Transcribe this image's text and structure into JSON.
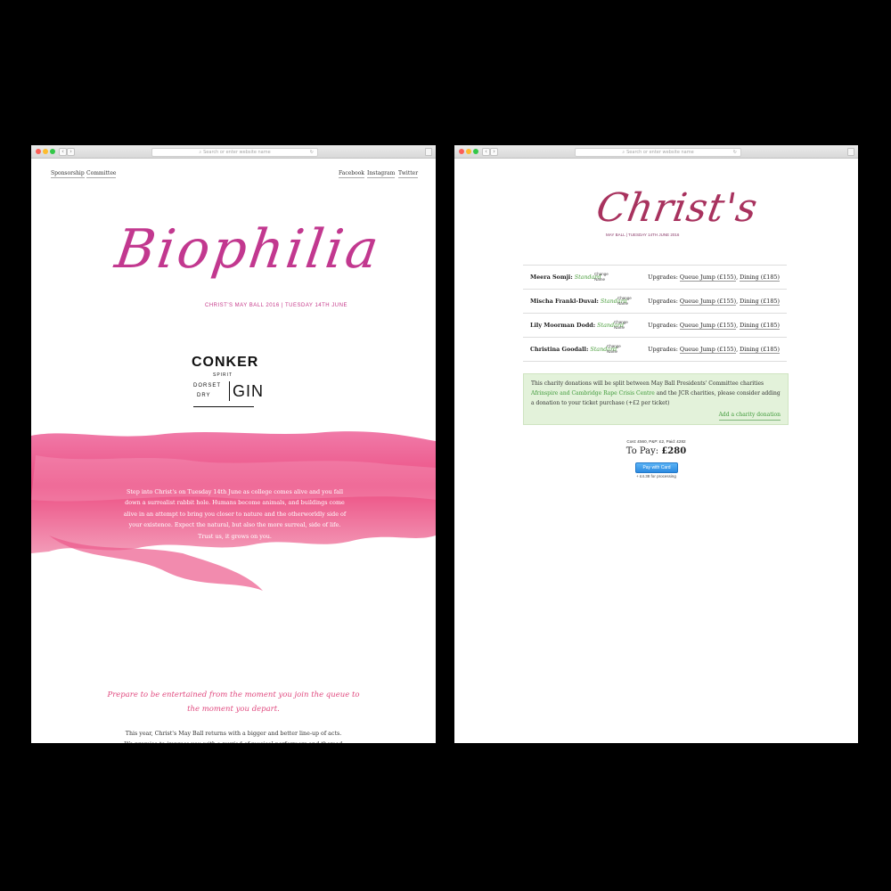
{
  "browser": {
    "url_placeholder": "Search or enter website name"
  },
  "left_page": {
    "nav_left": [
      "Sponsorship",
      "Committee"
    ],
    "nav_right": [
      "Facebook",
      "Instagram",
      "Twitter"
    ],
    "logo_script": "Biophilia",
    "tagline": "CHRIST'S MAY BALL 2016 | TUESDAY 14TH JUNE",
    "sponsor": {
      "word": "CONKER",
      "spirit": "SPIRIT",
      "dorset": "DORSET",
      "dry": "DRY",
      "gin": "GIN"
    },
    "intro": "Step into Christ's on Tuesday 14th June as college comes alive and you fall down a surrealist rabbit hole. Humans become animals, and buildings come alive in an attempt to bring you closer to nature and the otherworldly side of your existence. Expect the natural, but also the more surreal, side of life. Trust us, it grows on you.",
    "quote": "Prepare to be entertained from the moment you join the queue to the moment you depart.",
    "body": "This year, Christ's May Ball returns with a bigger and better line-up of acts. We promise to impress you with a myriad of musical performers and themed"
  },
  "right_page": {
    "logo_script": "Christ's",
    "tagline": "MAY BALL | TUESDAY 14TH JUNE 2016",
    "tickets": [
      {
        "name": "Meera Somji:",
        "type": "Standard",
        "change": "Change Name",
        "upgrades_label": "Upgrades:",
        "queue": "Queue Jump (£155)",
        "dining": "Dining (£185)"
      },
      {
        "name": "Mischa Frankl-Duval:",
        "type": "Standard",
        "change": "Change Name",
        "upgrades_label": "Upgrades:",
        "queue": "Queue Jump (£155)",
        "dining": "Dining (£185)"
      },
      {
        "name": "Lily Moorman Dodd:",
        "type": "Standard",
        "change": "Change Name",
        "upgrades_label": "Upgrades:",
        "queue": "Queue Jump (£155)",
        "dining": "Dining (£185)"
      },
      {
        "name": "Christina Goodall:",
        "type": "Standard",
        "change": "Change Name",
        "upgrades_label": "Upgrades:",
        "queue": "Queue Jump (£155)",
        "dining": "Dining (£185)"
      }
    ],
    "charity": {
      "text_a": "This charity donations will be split between May Ball Presidents' Committee charities ",
      "charity_names": "Afrinspire and Cambridge Rape Crisis Centre",
      "text_b": " and the JCR charities, please consider adding a donation to your ticket purchase (+£2 per ticket)",
      "link": "Add a charity donation"
    },
    "cost_line": "Cost: £560, P&P: £2, Paid: £282",
    "to_pay_label": "To Pay:",
    "to_pay_value": "£280",
    "pay_button": "Pay with Card",
    "processing": "+ £4.38 for processing"
  },
  "colors": {
    "background": "#000000",
    "accent_pink": "#e04a7f",
    "accent_green": "#4a9e3c",
    "button_blue": "#2d8be0"
  }
}
